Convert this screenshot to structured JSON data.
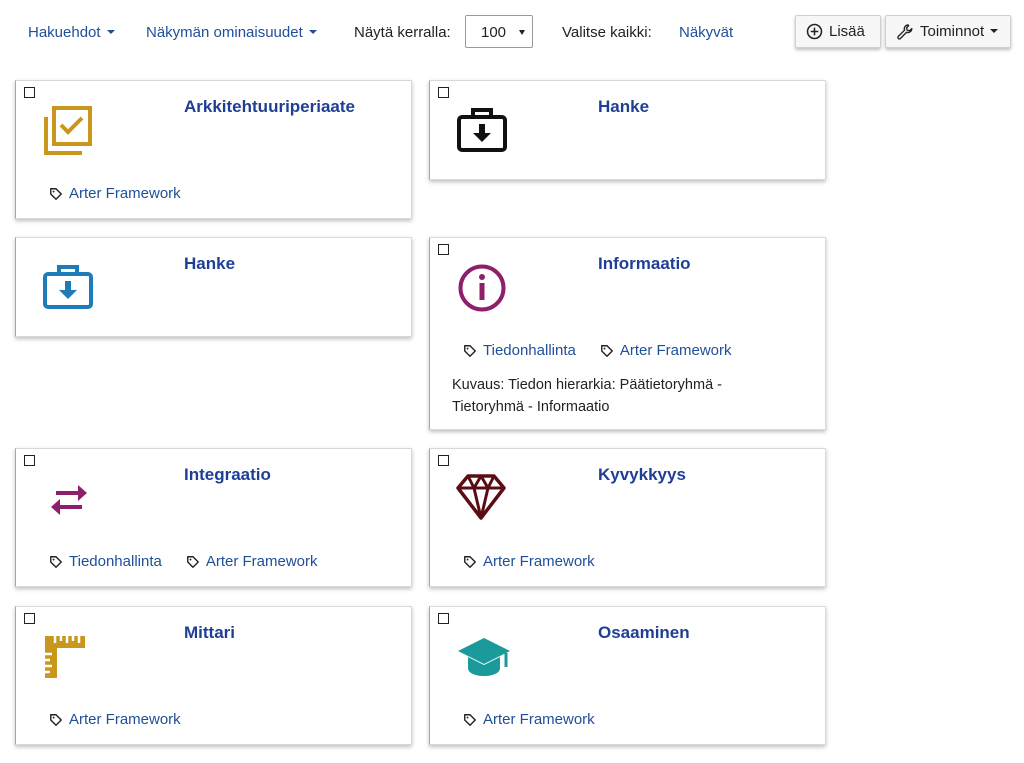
{
  "toolbar": {
    "search_conditions": "Hakuehdot",
    "view_properties": "Näkymän ominaisuudet",
    "show_at_once_label": "Näytä kerralla:",
    "show_at_once_value": "100",
    "select_all_label": "Valitse kaikki:",
    "visible_link": "Näkyvät",
    "add_button": "Lisää",
    "actions_button": "Toiminnot"
  },
  "cards": [
    {
      "title": "Arkkitehtuuriperiaate",
      "icon": "checkbox-stack-icon",
      "tags": [
        "Arter Framework"
      ],
      "description": ""
    },
    {
      "title": "Hanke",
      "icon": "briefcase-download-icon",
      "tags": [],
      "description": ""
    },
    {
      "title": "Hanke",
      "icon": "briefcase-download-icon",
      "tags": [],
      "description": ""
    },
    {
      "title": "Informaatio",
      "icon": "info-circle-icon",
      "tags": [
        "Tiedonhallinta",
        "Arter Framework"
      ],
      "description": "Kuvaus: Tiedon hierarkia: Päätietoryhmä - Tietoryhmä - Informaatio"
    },
    {
      "title": "Integraatio",
      "icon": "exchange-arrows-icon",
      "tags": [
        "Tiedonhallinta",
        "Arter Framework"
      ],
      "description": ""
    },
    {
      "title": "Kyvykkyys",
      "icon": "diamond-icon",
      "tags": [
        "Arter Framework"
      ],
      "description": ""
    },
    {
      "title": "Mittari",
      "icon": "ruler-icon",
      "tags": [
        "Arter Framework"
      ],
      "description": ""
    },
    {
      "title": "Osaaminen",
      "icon": "graduation-cap-icon",
      "tags": [
        "Arter Framework"
      ],
      "description": ""
    }
  ],
  "colors": {
    "link": "#1f4f99",
    "title": "#1f3f97",
    "gold": "#c9971c",
    "blue_icon": "#1c7bb8",
    "purple": "#8e1f6a",
    "dark_red": "#5a0d14",
    "teal": "#1a9a9a"
  }
}
